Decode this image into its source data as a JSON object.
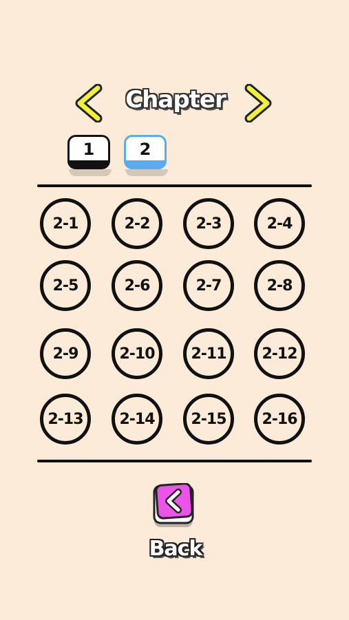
{
  "header": {
    "title": "Chapter",
    "prev_icon": "chevron-left-icon",
    "next_icon": "chevron-right-icon",
    "arrow_color": "#f2f03a"
  },
  "chapter_tabs": [
    {
      "label": "1",
      "selected": false
    },
    {
      "label": "2",
      "selected": true,
      "accent": "#5aaaf0"
    }
  ],
  "levels": [
    "2-1",
    "2-2",
    "2-3",
    "2-4",
    "2-5",
    "2-6",
    "2-7",
    "2-8",
    "2-9",
    "2-10",
    "2-11",
    "2-12",
    "2-13",
    "2-14",
    "2-15",
    "2-16"
  ],
  "footer": {
    "back_label": "Back",
    "back_icon": "chevron-left-icon",
    "back_color": "#ea55e8"
  }
}
